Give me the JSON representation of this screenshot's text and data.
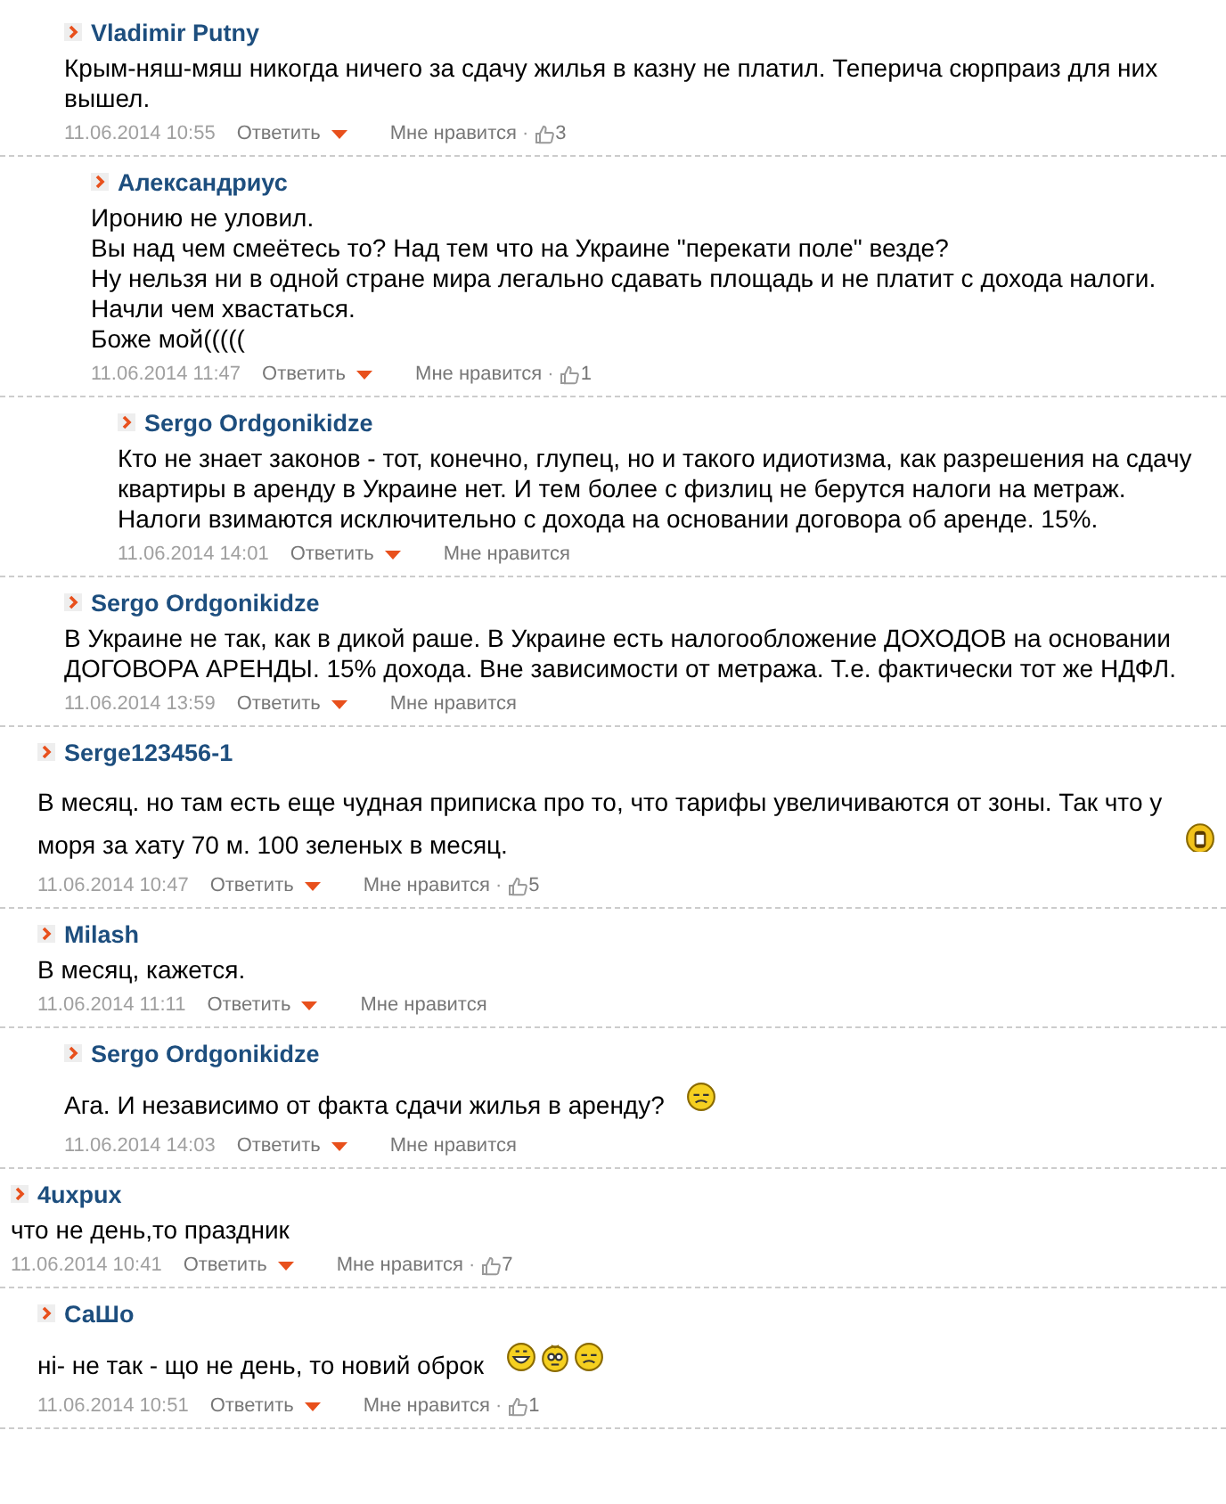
{
  "comments": [
    {
      "children": [
        {
          "children": [
            {
              "author": "Vladimir Putny",
              "text": "Крым-няш-мяш никогда ничего за сдачу жилья в казну не платил. Теперича сюрпраиз для них вышел.",
              "date": "11.06.2014 10:55",
              "reply": "Ответить",
              "like": "Мне нравится",
              "dot": "·",
              "likes": "3",
              "children": [
                {
                  "author": "Александриус",
                  "lines": [
                    "Иронию не уловил.",
                    "Вы над чем смеётесь то? Над тем что на Украине \"перекати поле\" везде?",
                    "Ну нельзя ни в одной стране мира легально сдавать площадь и не платит с дохода налоги.",
                    "Начли чем хвастаться.",
                    "Боже мой((((("
                  ],
                  "date": "11.06.2014 11:47",
                  "reply": "Ответить",
                  "like": "Мне нравится",
                  "dot": "·",
                  "likes": "1",
                  "children": [
                    {
                      "author": "Sergo Ordgonikidze",
                      "text": "Кто не знает законов - тот, конечно, глупец, но и такого идиотизма, как разрешения на сдачу квартиры в аренду в Украине нет. И тем более с физлиц не берутся налоги на метраж. Налоги взимаются исключительно с дохода на основании договора об аренде. 15%.",
                      "date": "11.06.2014 14:01",
                      "reply": "Ответить",
                      "like": "Мне нравится"
                    }
                  ]
                }
              ]
            },
            {
              "author": "Sergo Ordgonikidze",
              "text": "В Украине не так, как в дикой раше. В Украине есть налогообложение ДОХОДОВ на основании ДОГОВОРА АРЕНДЫ. 15% дохода. Вне зависимости от метража. Т.е. фактически тот же НДФЛ.",
              "date": "11.06.2014 13:59",
              "reply": "Ответить",
              "like": "Мне нравится"
            }
          ]
        },
        {
          "author": "Serge123456-1",
          "text": "В месяц. но там есть еще чудная приписка про то, что тарифы увеличиваются от зоны. Так что у моря за хату 70 м. 100 зеленых в месяц.",
          "emoticons": [
            {
              "kind": "scared"
            }
          ],
          "date": "11.06.2014 10:47",
          "reply": "Ответить",
          "like": "Мне нравится",
          "dot": "·",
          "likes": "5"
        },
        {
          "author": "Milash",
          "text": "В месяц, кажется.",
          "date": "11.06.2014 11:11",
          "reply": "Ответить",
          "like": "Мне нравится",
          "children": [
            {
              "author": "Sergo Ordgonikidze",
              "text": "Ага. И независимо от факта сдачи жилья в аренду?",
              "emoticons": [
                {
                  "kind": "doubt"
                }
              ],
              "date": "11.06.2014 14:03",
              "reply": "Ответить",
              "like": "Мне нравится"
            }
          ]
        }
      ]
    },
    {
      "author": "4uxpux",
      "text": "что не день,то праздник",
      "date": "11.06.2014 10:41",
      "reply": "Ответить",
      "like": "Мне нравится",
      "dot": "·",
      "likes": "7",
      "children": [
        {
          "author": "СаШо",
          "text": "ні- не так - що не день, то новий оброк",
          "emoticons": [
            {
              "kind": "grin"
            },
            {
              "kind": "dizzy"
            },
            {
              "kind": "doubt"
            }
          ],
          "date": "11.06.2014 10:51",
          "reply": "Ответить",
          "like": "Мне нравится",
          "dot": "·",
          "likes": "1"
        }
      ]
    }
  ]
}
